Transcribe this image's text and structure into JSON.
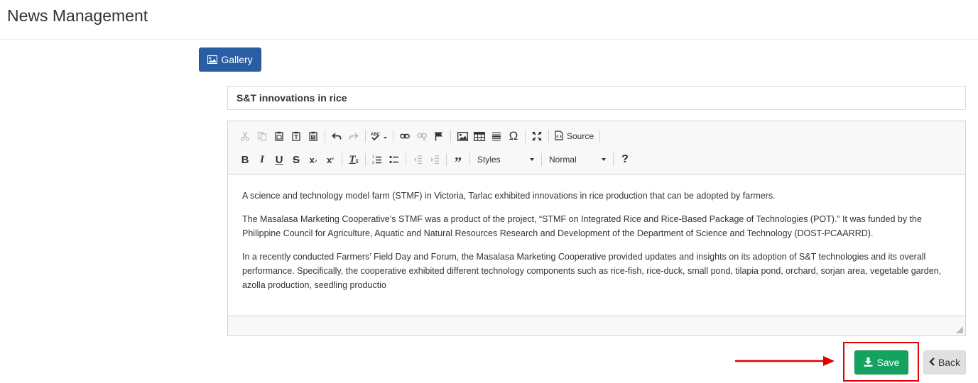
{
  "header": {
    "title": "News Management"
  },
  "gallery_button": {
    "label": "Gallery",
    "icon": "image-icon"
  },
  "news_title": {
    "value": "S&T innovations in rice"
  },
  "toolbar": {
    "row1": [
      "cut-icon",
      "copy-icon",
      "paste-icon",
      "paste-text-icon",
      "paste-word-icon",
      "undo-icon",
      "redo-icon",
      "spellcheck-icon",
      "link-icon",
      "unlink-icon",
      "anchor-icon",
      "image-icon",
      "table-icon",
      "horizontal-line-icon",
      "special-char-icon",
      "maximize-icon",
      "source-icon"
    ],
    "source_label": "Source",
    "row2": [
      "bold-icon",
      "italic-icon",
      "underline-icon",
      "strike-icon",
      "subscript-icon",
      "superscript-icon",
      "remove-format-icon",
      "numbered-list-icon",
      "bulleted-list-icon",
      "outdent-icon",
      "indent-icon",
      "blockquote-icon",
      "help-icon"
    ],
    "styles_label": "Styles",
    "format_label": "Normal",
    "help_label": "?"
  },
  "content": {
    "paragraphs": [
      "A science and technology model farm (STMF) in Victoria, Tarlac exhibited innovations in rice production that can be adopted by farmers.",
      "The Masalasa Marketing Cooperative’s STMF was a product of the project, “STMF on Integrated Rice and Rice-Based Package of Technologies (POT).” It was funded by the Philippine Council for Agriculture, Aquatic and Natural Resources Research and Development of the Department of Science and Technology (DOST-PCAARRD).",
      "In a recently conducted Farmers’ Field Day and Forum, the Masalasa Marketing Cooperative provided updates and insights on its adoption of S&T technologies and its overall performance. Specifically, the cooperative exhibited different technology components such as rice-fish, rice-duck, small pond, tilapia pond, orchard, sorjan area, vegetable garden, azolla production, seedling productio"
    ]
  },
  "actions": {
    "save_label": "Save",
    "back_label": "Back",
    "save_color": "#14a25f",
    "annotation_color": "#e00000"
  }
}
